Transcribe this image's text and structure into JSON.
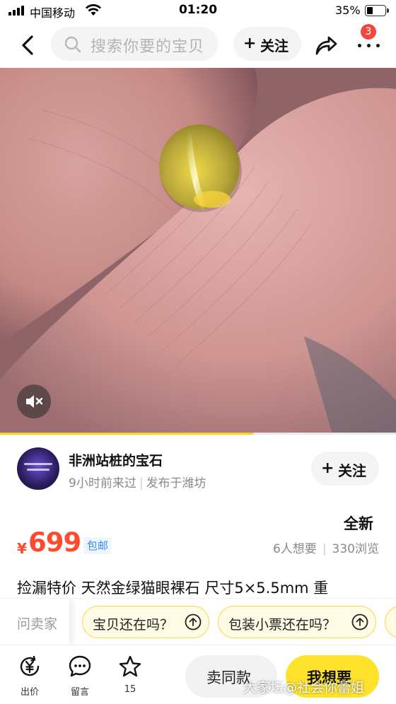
{
  "status_bar": {
    "carrier": "中国移动",
    "time": "01:20",
    "battery": "35%",
    "battery_level": 0.35
  },
  "nav": {
    "search_placeholder": "搜索你要的宝贝",
    "follow_label": "关注",
    "cart_badge": "3",
    "icons": [
      "back-icon",
      "search-icon",
      "share-icon",
      "more-icon"
    ]
  },
  "media": {
    "description": "product photo",
    "video_progress": 0.64,
    "mute_icon": "volume-mute-icon"
  },
  "seller": {
    "name": "非洲站桩的宝石",
    "last_seen": "9小时前来过",
    "location": "发布于潍坊",
    "follow_label": "关注"
  },
  "product": {
    "condition": "全新",
    "currency": "¥",
    "price": "699",
    "shipping_tag": "包邮",
    "wants": "6人想要",
    "views": "330浏览",
    "title": "捡漏特价 天然金绿猫眼裸石 尺寸5×5.5mm 重"
  },
  "quick_questions": {
    "ask_label": "问卖家",
    "chips": [
      "宝贝还在吗？",
      "包装小票还在吗？"
    ]
  },
  "bottom_bar": {
    "actions": [
      {
        "label": "出价",
        "icon": "yen-offer-icon"
      },
      {
        "label": "留言",
        "icon": "comment-icon"
      },
      {
        "label": "15",
        "icon": "star-icon"
      }
    ],
    "sell_same_label": "卖同款",
    "want_label": "我想要"
  },
  "watermark": "大家坛@社会你蕾姐",
  "colors": {
    "accent_yellow": "#ffe22b",
    "price_red": "#ff4a2e",
    "ship_blue": "#3d8bf2",
    "badge_red": "#f0483e"
  }
}
